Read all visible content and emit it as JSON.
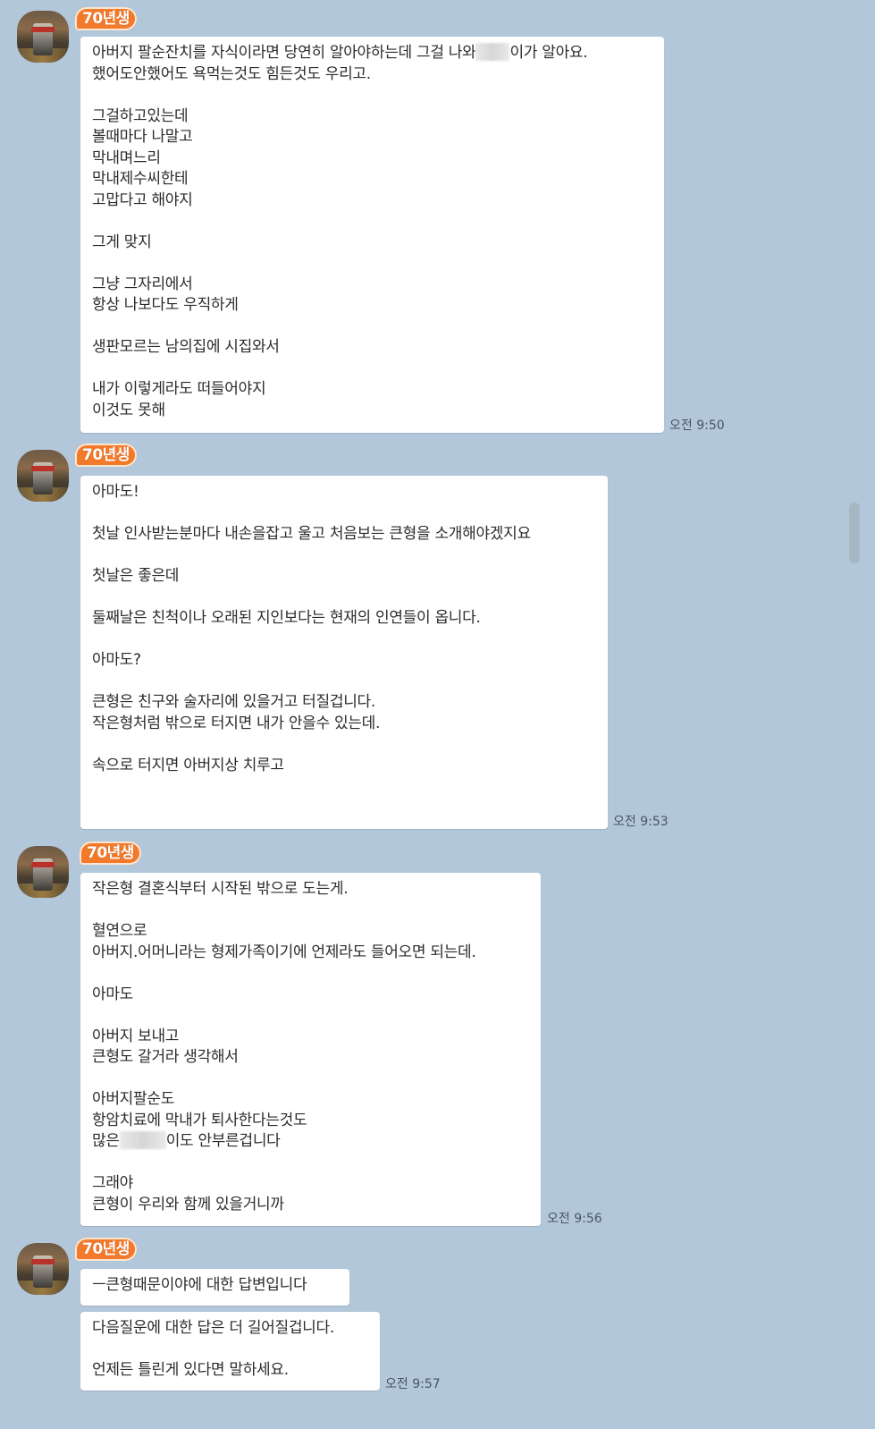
{
  "chat": {
    "sender_name": "70년생",
    "messages": [
      {
        "lines_before_blur": "아버지 팔순잔치를 자식이라면 당연히 알아야하는데 그걸 나와",
        "line1_after_blur": "이가 알아요.",
        "lines": [
          "했어도안했어도 욕먹는것도 힘든것도 우리고.",
          "",
          "그걸하고있는데",
          "볼때마다 나말고",
          "막내며느리",
          "막내제수씨한테",
          "고맙다고 해야지",
          "",
          "그게 맞지",
          "",
          "그냥 그자리에서",
          "항상 나보다도 우직하게",
          "",
          "생판모르는 남의집에 시집와서",
          "",
          "내가 이렇게라도 떠들어야지",
          "이것도 못해"
        ],
        "time": "오전 9:50"
      },
      {
        "lines": [
          "아마도!",
          "",
          "첫날 인사받는분마다 내손을잡고 울고 처음보는 큰형을 소개해야겠지요",
          "",
          "첫날은 좋은데",
          "",
          "둘째날은 친척이나 오래된 지인보다는 현재의 인연들이 옵니다.",
          "",
          "아마도?",
          "",
          "큰형은 친구와 술자리에 있을거고 터질겁니다.",
          "작은형처럼 밖으로 터지면 내가 안을수 있는데.",
          "",
          "속으로 터지면 아버지상 치루고",
          ""
        ],
        "time": "오전 9:53"
      },
      {
        "lines": [
          "작은형 결혼식부터 시작된 밖으로 도는게.",
          "",
          "혈연으로",
          "아버지.어머니라는 형제가족이기에 언제라도 들어오면 되는데.",
          "",
          "아마도",
          "",
          "아버지 보내고",
          "큰형도 갈거라 생각해서",
          "",
          "아버지팔순도",
          "항암치료에 막내가 퇴사한다는것도"
        ],
        "line_blur_before": "많은",
        "line_blur_after": "이도 안부른겁니다",
        "lines_after": [
          "",
          "그래야",
          "큰형이 우리와 함께 있을거니까"
        ],
        "time": "오전 9:56"
      },
      {
        "bubble1": "ㅡ큰형때문이야에 대한 답변입니다",
        "bubble2_lines": [
          "다음질운에 대한 답은 더 길어질겁니다.",
          "",
          "언제든 틀린게 있다면 말하세요."
        ],
        "time": "오전 9:57"
      }
    ]
  }
}
